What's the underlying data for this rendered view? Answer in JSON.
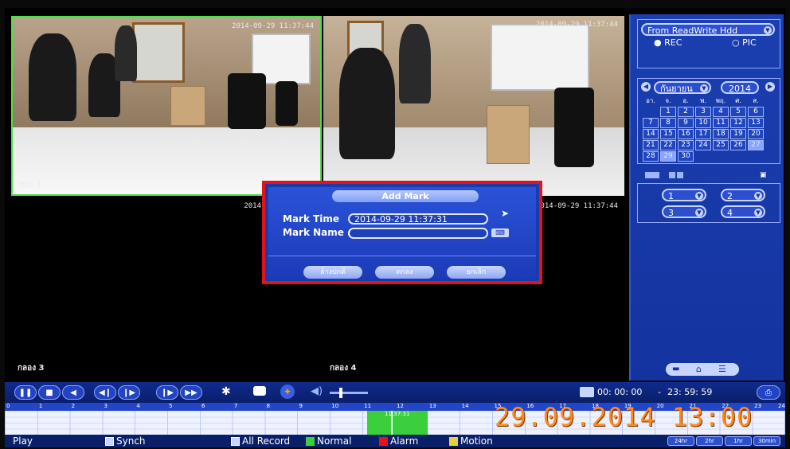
{
  "cameras": [
    {
      "timestamp": "2014-09-29 11:37:44",
      "label": "ช่อง 1"
    },
    {
      "timestamp": "2014-09-29 11:37:44",
      "label": ""
    },
    {
      "timestamp": "2014",
      "label": "กลอง 3"
    },
    {
      "timestamp": "2014-09-29 11:37:44",
      "label": "กลอง 4"
    }
  ],
  "sidebar": {
    "source": "From ReadWrite Hdd",
    "rec_label": "REC",
    "pic_label": "PIC",
    "month": "กันยายน",
    "year": "2014",
    "weekdays": [
      "อา.",
      "จ.",
      "อ.",
      "พ.",
      "พฤ.",
      "ศ.",
      "ส."
    ],
    "calendar_rows": [
      [
        "",
        "1",
        "2",
        "3",
        "4",
        "5",
        "6"
      ],
      [
        "7",
        "8",
        "9",
        "10",
        "11",
        "12",
        "13"
      ],
      [
        "14",
        "15",
        "16",
        "17",
        "18",
        "19",
        "20"
      ],
      [
        "21",
        "22",
        "23",
        "24",
        "25",
        "26",
        "27"
      ],
      [
        "28",
        "29",
        "30",
        "",
        "",
        "",
        ""
      ]
    ],
    "selected_days": [
      "27",
      "29"
    ],
    "channel_selects": [
      "1",
      "2",
      "3",
      "4"
    ]
  },
  "dialog": {
    "title": "Add Mark",
    "mark_time_label": "Mark Time",
    "mark_time_value": "2014-09-29 11:37:31",
    "mark_name_label": "Mark Name",
    "mark_name_value": "",
    "buttons": [
      "ล้างปกติ",
      "ตกลง",
      "ยกเลิก"
    ]
  },
  "toolbar": {
    "time_range_start": "00: 00: 00",
    "time_range_sep": "-",
    "time_range_end": "23: 59: 59"
  },
  "timeline": {
    "hours": [
      "0",
      "1",
      "2",
      "3",
      "4",
      "5",
      "6",
      "7",
      "8",
      "9",
      "10",
      "11",
      "12",
      "13",
      "14",
      "15",
      "16",
      "17",
      "18",
      "19",
      "20",
      "21",
      "22",
      "23",
      "24"
    ],
    "green_label": "11:37:31"
  },
  "statusbar": {
    "play": "Play",
    "synch": "Synch",
    "all_record": "All Record",
    "normal": "Normal",
    "alarm": "Alarm",
    "motion": "Motion",
    "zoom": [
      "24hr",
      "2hr",
      "1hr",
      "30min"
    ]
  },
  "photo_date_overlay": "29.09.2014 13:00",
  "colors": {
    "panel_blue": "#1a3bb0",
    "highlight_red": "#e0151b",
    "timeline_green": "#3ccf3c",
    "overlay_orange": "#ff8a1a"
  }
}
